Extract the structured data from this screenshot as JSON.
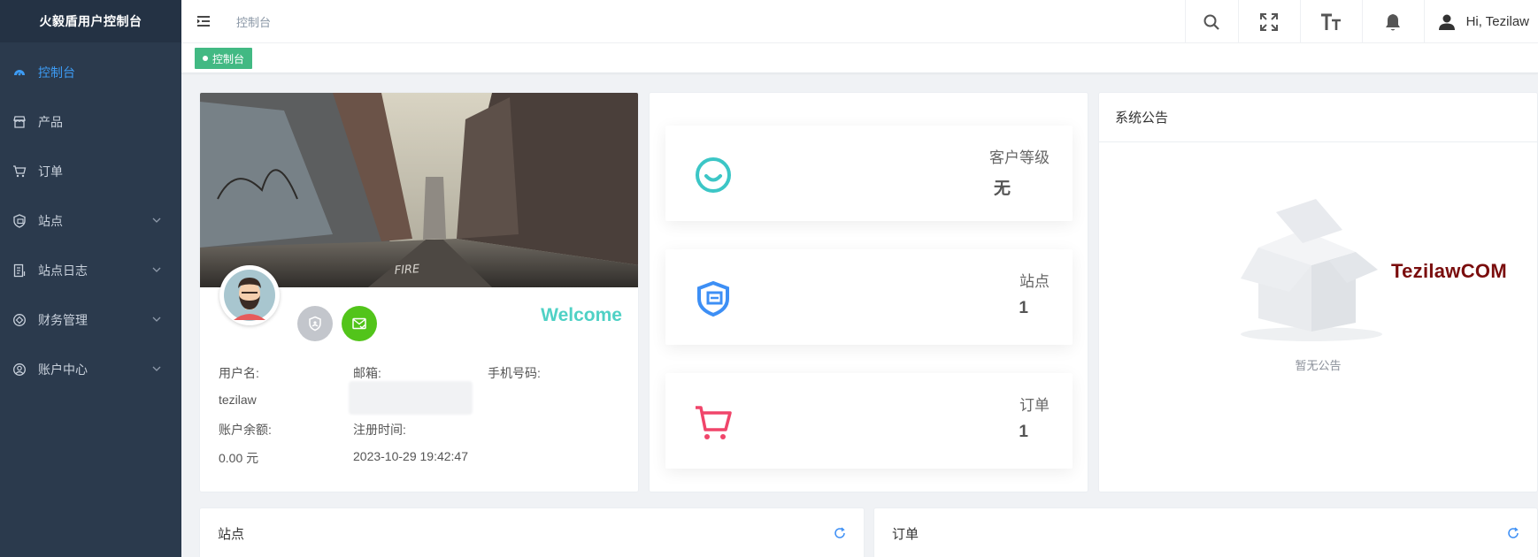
{
  "brand": "火毅盾用户控制台",
  "sidebar": {
    "items": [
      {
        "label": "控制台",
        "icon": "dashboard-icon",
        "active": true,
        "has_children": false
      },
      {
        "label": "产品",
        "icon": "store-icon",
        "active": false,
        "has_children": false
      },
      {
        "label": "订单",
        "icon": "cart-icon",
        "active": false,
        "has_children": false
      },
      {
        "label": "站点",
        "icon": "site-icon",
        "active": false,
        "has_children": true
      },
      {
        "label": "站点日志",
        "icon": "log-icon",
        "active": false,
        "has_children": true
      },
      {
        "label": "财务管理",
        "icon": "finance-icon",
        "active": false,
        "has_children": true
      },
      {
        "label": "账户中心",
        "icon": "account-icon",
        "active": false,
        "has_children": true
      }
    ]
  },
  "header": {
    "breadcrumb": "控制台",
    "user_greeting": "Hi, Tezilaw"
  },
  "tags": {
    "active": "控制台"
  },
  "profile": {
    "welcome": "Welcome",
    "username_label": "用户名:",
    "username": "tezilaw",
    "email_label": "邮箱:",
    "phone_label": "手机号码:",
    "balance_label": "账户余额:",
    "balance": "0.00 元",
    "register_label": "注册时间:",
    "register_time": "2023-10-29 19:42:47"
  },
  "stats": [
    {
      "label": "客户等级",
      "value": "无",
      "icon": "smile-icon",
      "color": "#3cc6c6"
    },
    {
      "label": "站点",
      "value": "1",
      "icon": "shield-site-icon",
      "color": "#3d8ff5"
    },
    {
      "label": "订单",
      "value": "1",
      "icon": "cart-icon",
      "color": "#f0456a"
    }
  ],
  "notice": {
    "title": "系统公告",
    "empty": "暂无公告",
    "watermark": "TezilawCOM"
  },
  "bottom": {
    "sites_title": "站点",
    "orders_title": "订单"
  },
  "colors": {
    "sidebar_bg": "#2b3a4d",
    "accent": "#3d9cf5",
    "tag_green": "#42b983",
    "welcome": "#4fd1c5"
  }
}
